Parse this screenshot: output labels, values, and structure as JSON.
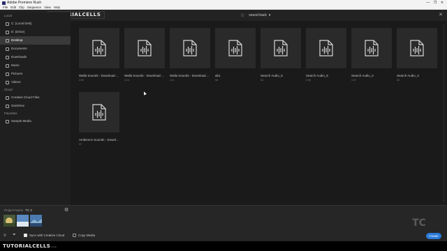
{
  "window": {
    "title": "Adobe Premiere Rush",
    "controls": [
      "—",
      "❐",
      "✕"
    ]
  },
  "menu": [
    "File",
    "Edit",
    "Clip",
    "Sequence",
    "View",
    "Help"
  ],
  "logo_text": "TUTORIALCELLS",
  "location": {
    "label": "sound back"
  },
  "sidebar": {
    "local_heading": "Local",
    "local": [
      "C: (Local Disk)",
      "D: (Drive)",
      "Desktop",
      "Documents",
      "Downloads",
      "Music",
      "Pictures",
      "Videos"
    ],
    "cloud_heading": "Cloud",
    "cloud": [
      "Creative Cloud Files",
      "OneDrive"
    ],
    "favorites_heading": "Favorites",
    "favorites": [
      "Sample Media"
    ],
    "active_item": "Desktop"
  },
  "files": [
    {
      "name": "Walla Sounds - Download ...",
      "meta": "2:09"
    },
    {
      "name": "Walla Sounds - Download ...",
      "meta": "1:14"
    },
    {
      "name": "Walla Sounds - Download ...",
      "meta": "1:11"
    },
    {
      "name": "ab1",
      "meta": "06"
    },
    {
      "name": "Search Audio_6",
      "meta": "04"
    },
    {
      "name": "Search Audio_5",
      "meta": "2:06"
    },
    {
      "name": "Search Audio_4",
      "meta": "1:07"
    },
    {
      "name": "Search Audio_3",
      "meta": "06"
    },
    {
      "name": "Ambience Sounds - Downl...",
      "meta": "37"
    }
  ],
  "bottom": {
    "project_name_label": "Project Name",
    "project_name": "TC 3",
    "sync_label": "Sync with Creative Cloud",
    "sync_checked": true,
    "copy_label": "Copy Media",
    "copy_checked": false,
    "create_label": "Create"
  },
  "footer": {
    "brand": "TUTORIALCELLS",
    "brand_suffix": ".com"
  },
  "watermark": "TC"
}
